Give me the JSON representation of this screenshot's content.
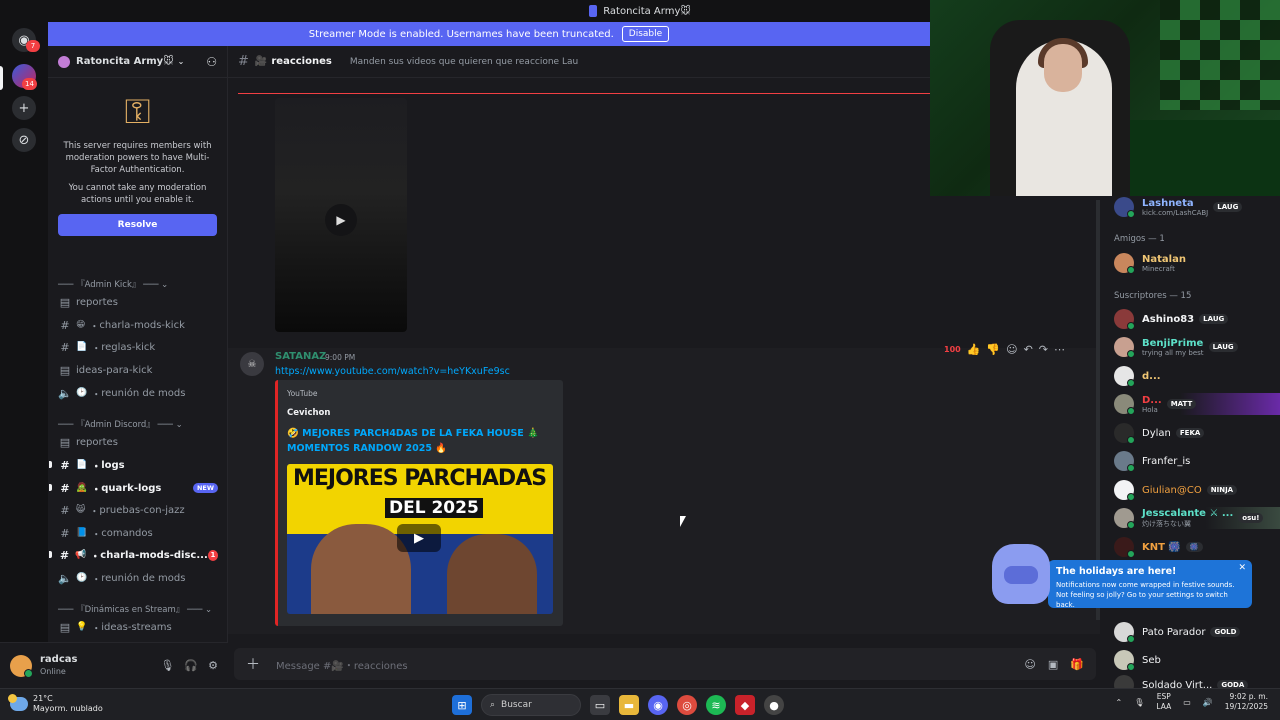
{
  "titlebar": {
    "title": "Ratoncita Army🐭"
  },
  "guildbar": {
    "dm_badge": "7",
    "server_badge": "14"
  },
  "banner": {
    "text": "Streamer Mode is enabled. Usernames have been truncated.",
    "button": "Disable"
  },
  "server": {
    "name": "Ratoncita Army🐭"
  },
  "mfa": {
    "text1": "This server requires members with moderation powers to have Multi-Factor Authentication.",
    "text2": "You cannot take any moderation actions until you enable it.",
    "button": "Resolve"
  },
  "sidebar": {
    "categories": [
      "『Admin Kick』",
      "『Admin Discord』",
      "『Dinámicas en Stream』"
    ],
    "channels": [
      {
        "name": "reportes",
        "icon": "forum-icon",
        "emoji": ""
      },
      {
        "name": "charla-mods-kick",
        "icon": "hash-icon",
        "emoji": "😁"
      },
      {
        "name": "reglas-kick",
        "icon": "hash-icon",
        "emoji": "📄"
      },
      {
        "name": "ideas-para-kick",
        "icon": "forum-icon",
        "emoji": ""
      },
      {
        "name": "reunión de mods",
        "icon": "voice-icon",
        "emoji": "🕑"
      },
      {
        "name": "reportes",
        "icon": "forum-icon",
        "emoji": ""
      },
      {
        "name": "logs",
        "icon": "hash-icon",
        "emoji": "📄"
      },
      {
        "name": "quark-logs",
        "icon": "hash-icon",
        "emoji": "🧟"
      },
      {
        "name": "pruebas-con-jazz",
        "icon": "hash-icon",
        "emoji": "😸"
      },
      {
        "name": "comandos",
        "icon": "hash-icon",
        "emoji": "📘"
      },
      {
        "name": "charla-mods-disc...",
        "icon": "hash-icon",
        "emoji": "📢"
      },
      {
        "name": "reunión de mods",
        "icon": "voice-icon",
        "emoji": "🕑"
      },
      {
        "name": "ideas-streams",
        "icon": "forum-icon",
        "emoji": "💡"
      }
    ],
    "new_badge": "NEW",
    "unread_count": "1"
  },
  "user": {
    "name": "radcas",
    "status": "Online"
  },
  "channel_header": {
    "name": "reacciones",
    "topic": "Manden sus videos que quieren que reaccione Lau"
  },
  "message": {
    "author": "SATANAZ",
    "time": "9:00 PM",
    "link": "https://www.youtube.com/watch?v=heYKxuFe9sc",
    "embed": {
      "provider": "YouTube",
      "author": "Cevichon",
      "title": "🤣 MEJORES PARCH4DAS DE LA FEKA HOUSE 🎄 MOMENTOS RANDOW 2025 🔥",
      "thumb_line1": "MEJORES PARCHADAS",
      "thumb_line2": "DEL 2025"
    }
  },
  "composer": {
    "placeholder": "Message #🎥・reacciones"
  },
  "members": {
    "groups": [
      "Amigos — 1",
      "Suscriptores — 15"
    ],
    "list": [
      {
        "name": "Lashneta",
        "sub": "kick.com/LashCABJ",
        "tag": "LAUG",
        "color": "#8fb4ff"
      },
      {
        "name": "Natalan",
        "sub": "Minecraft",
        "tag": "",
        "color": "#f0c674"
      },
      {
        "name": "Ashino83",
        "sub": "",
        "tag": "LAUG",
        "color": "#f2f3f5"
      },
      {
        "name": "BenjiPrime",
        "sub": "trying all my best",
        "tag": "LAUG",
        "color": "#5de0c8"
      },
      {
        "name": "d...",
        "sub": "",
        "tag": "",
        "color": "#f0c674"
      },
      {
        "name": "D...",
        "sub": "Hola",
        "tag": "MATT",
        "color": "#f23f43"
      },
      {
        "name": "Dylan",
        "sub": "",
        "tag": "FEKA",
        "color": "#f2f3f5"
      },
      {
        "name": "Franfer_is",
        "sub": "",
        "tag": "",
        "color": "#f2f3f5"
      },
      {
        "name": "Giulian@CO",
        "sub": "",
        "tag": "NINJA",
        "color": "#f0a040"
      },
      {
        "name": "Jesscalante ⚔ ...",
        "sub": "灼け落ちない翼",
        "tag": "osu!",
        "color": "#5de0c8"
      },
      {
        "name": "KNT 🎆",
        "sub": "",
        "tag": "🎆",
        "color": "#f0a040"
      },
      {
        "name": "Pato Parador",
        "sub": "",
        "tag": "GOLD",
        "color": "#f2f3f5"
      },
      {
        "name": "Seb",
        "sub": "",
        "tag": "",
        "color": "#f2f3f5"
      },
      {
        "name": "Soldado Virt...",
        "sub": "",
        "tag": "GODA",
        "color": "#f2f3f5"
      }
    ]
  },
  "toast": {
    "title": "The holidays are here!",
    "body": "Notifications now come wrapped in festive sounds. Not feeling so jolly? Go to your settings to switch back."
  },
  "taskbar": {
    "temp": "21°C",
    "weather": "Mayorm. nublado",
    "search": "Buscar",
    "lang1": "ESP",
    "lang2": "LAA",
    "time": "9:02 p. m.",
    "date": "19/12/2025"
  }
}
